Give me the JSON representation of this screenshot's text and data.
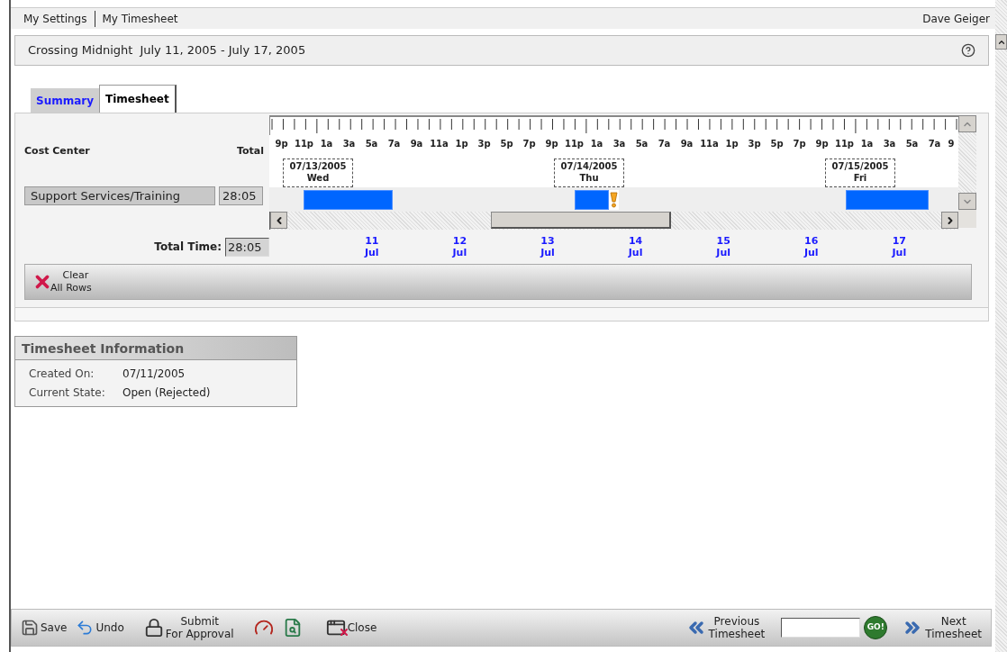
{
  "top_nav": {
    "links": [
      "My Settings",
      "My Timesheet"
    ],
    "user": "Dave Geiger"
  },
  "header": {
    "title": "Crossing Midnight",
    "date_range": "July 11, 2005 - July 17, 2005"
  },
  "tabs": [
    {
      "label": "Summary",
      "selected": false
    },
    {
      "label": "Timesheet",
      "selected": true
    }
  ],
  "timesheet": {
    "columns": [
      "Cost Center",
      "Total"
    ],
    "hour_labels": [
      "9p",
      "11p",
      "1a",
      "3a",
      "5a",
      "7a",
      "9a",
      "11a",
      "1p",
      "3p",
      "5p",
      "7p",
      "9p",
      "11p",
      "1a",
      "3a",
      "5a",
      "7a",
      "9a",
      "11a",
      "1p",
      "3p",
      "5p",
      "7p",
      "9p",
      "11p",
      "1a",
      "3a",
      "5a",
      "7a",
      "9"
    ],
    "day_markers": [
      {
        "date": "07/13/2005",
        "day": "Wed"
      },
      {
        "date": "07/14/2005",
        "day": "Thu"
      },
      {
        "date": "07/15/2005",
        "day": "Fri"
      }
    ],
    "rows": [
      {
        "cost_center": "Support Services/Training",
        "total": "28:05",
        "entries": [
          {
            "warning": false
          },
          {
            "warning": true
          },
          {
            "warning": false
          }
        ]
      }
    ],
    "total_label": "Total Time:",
    "total_value": "28:05",
    "day_labels": [
      {
        "day": "11",
        "month": "Jul"
      },
      {
        "day": "12",
        "month": "Jul"
      },
      {
        "day": "13",
        "month": "Jul"
      },
      {
        "day": "14",
        "month": "Jul"
      },
      {
        "day": "15",
        "month": "Jul"
      },
      {
        "day": "16",
        "month": "Jul"
      },
      {
        "day": "17",
        "month": "Jul"
      }
    ],
    "clear_button": [
      "Clear",
      "All Rows"
    ]
  },
  "info": {
    "title": "Timesheet Information",
    "fields": [
      {
        "label": "Created On:",
        "value": "07/11/2005"
      },
      {
        "label": "Current State:",
        "value": "Open (Rejected)"
      }
    ]
  },
  "toolbar": {
    "left": [
      {
        "kind": "save",
        "lines": [
          "Save"
        ]
      },
      {
        "kind": "undo",
        "lines": [
          "Undo"
        ]
      },
      {
        "kind": "submit",
        "lines": [
          "Submit",
          "For Approval"
        ]
      },
      {
        "kind": "gauge"
      },
      {
        "kind": "inspect"
      },
      {
        "kind": "close",
        "lines": [
          "Close"
        ]
      }
    ],
    "previous": [
      "Previous",
      "Timesheet"
    ],
    "go": "GO!",
    "next": [
      "Next",
      "Timesheet"
    ]
  }
}
